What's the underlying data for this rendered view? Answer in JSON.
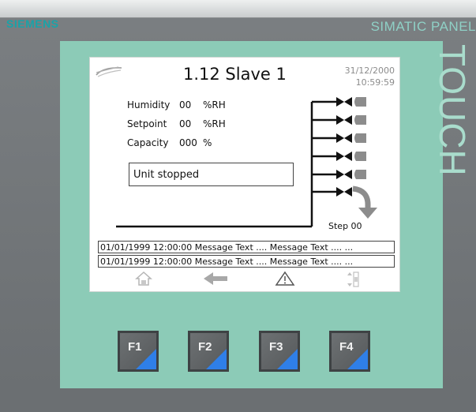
{
  "device": {
    "brand": "SIEMENS",
    "model": "SIMATIC PANEL",
    "touch_label": "TOUCH"
  },
  "screen": {
    "title": "1.12 Slave 1",
    "date": "31/12/2000",
    "time": "10:59:59",
    "readings": [
      {
        "label": "Humidity",
        "value": "00",
        "unit": "%RH"
      },
      {
        "label": "Setpoint",
        "value": "00",
        "unit": "%RH"
      },
      {
        "label": "Capacity",
        "value": "000",
        "unit": "%"
      }
    ],
    "status": "Unit stopped",
    "step": "Step 00",
    "messages": [
      "01/01/1999 12:00:00 Message Text .... Message Text .... ...",
      "01/01/1999 12:00:00 Message Text .... Message Text .... ..."
    ],
    "nav_icons": [
      "home-icon",
      "back-arrow-icon",
      "alarm-warning-icon",
      "scroll-icon"
    ]
  },
  "function_keys": [
    "F1",
    "F2",
    "F3",
    "F4"
  ],
  "colors": {
    "bezel": "#8ccbb7",
    "brand": "#1aa3a8",
    "fkey_accent": "#2f7fe8"
  }
}
